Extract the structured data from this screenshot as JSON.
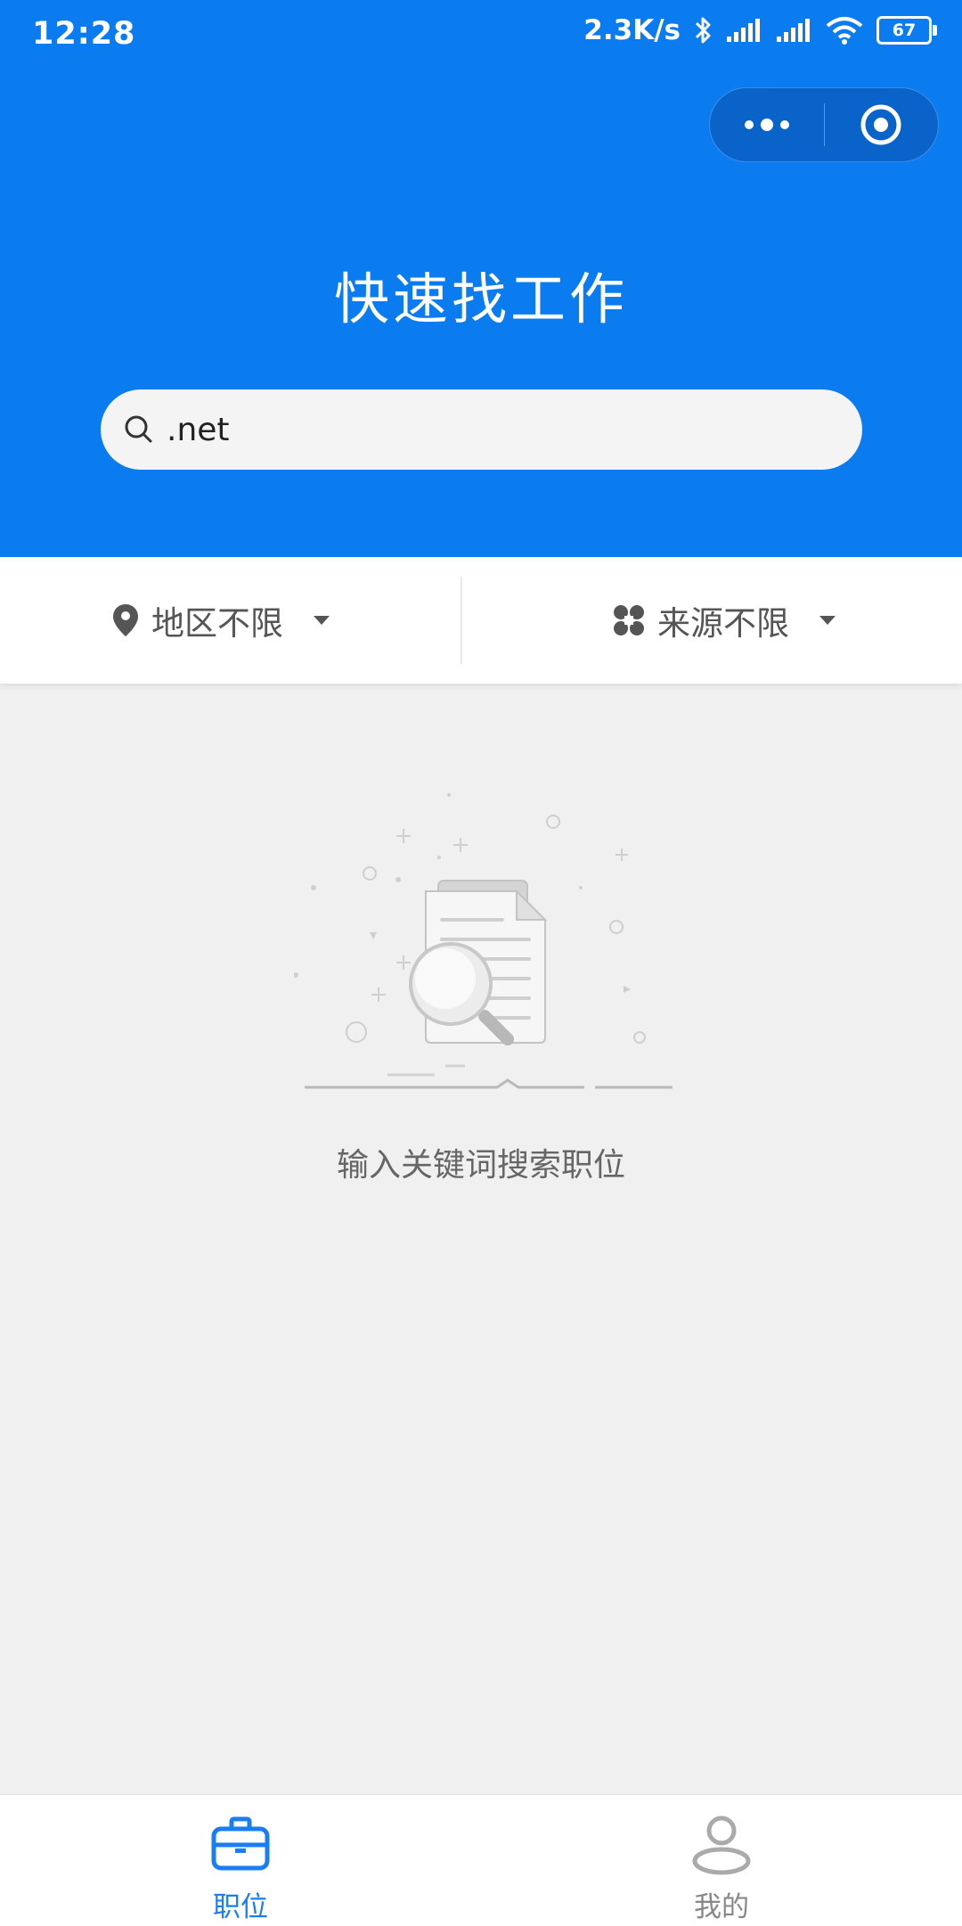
{
  "status_bar": {
    "time": "12:28",
    "speed": "2.3K/s",
    "battery": "67"
  },
  "header": {
    "title": "快速找工作",
    "background_color": "#0a7cf0"
  },
  "search": {
    "value": ".net"
  },
  "filters": {
    "region_label": "地区不限",
    "source_label": "来源不限"
  },
  "empty_state": {
    "message": "输入关键词搜索职位"
  },
  "tabbar": {
    "tabs": [
      {
        "label": "职位",
        "icon": "briefcase-icon",
        "active": true,
        "color": "#1a7ef0"
      },
      {
        "label": "我的",
        "icon": "user-icon",
        "active": false,
        "color": "#888888"
      }
    ]
  }
}
